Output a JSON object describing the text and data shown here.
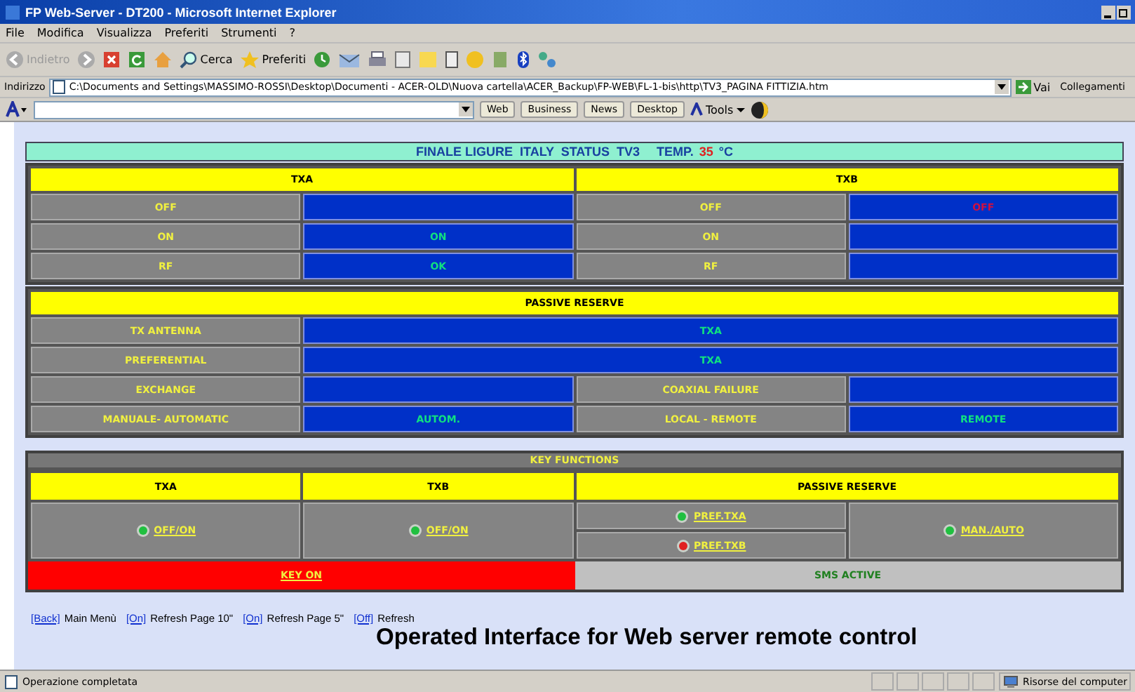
{
  "window": {
    "title": "FP Web-Server - DT200 - Microsoft Internet Explorer"
  },
  "menu": [
    "File",
    "Modifica",
    "Visualizza",
    "Preferiti",
    "Strumenti",
    "?"
  ],
  "toolbar": {
    "back": "Indietro",
    "search": "Cerca",
    "favorites": "Preferiti"
  },
  "address_bar": {
    "label": "Indirizzo",
    "value": "C:\\Documents and Settings\\MASSIMO-ROSSI\\Desktop\\Documenti - ACER-OLD\\Nuova cartella\\ACER_Backup\\FP-WEB\\FL-1-bis\\http\\TV3_PAGINA FITTIZIA.htm",
    "go": "Vai",
    "links": "Collegamenti"
  },
  "search_toolbar": {
    "buttons": [
      "Web",
      "Business",
      "News",
      "Desktop"
    ],
    "tools": "Tools"
  },
  "header": {
    "title": "FINALE LIGURE  ITALY  STATUS  TV3",
    "temp_label": "TEMP.",
    "temp_value": "35",
    "temp_unit": "°C"
  },
  "transmitters": [
    {
      "name": "TXA",
      "rows": [
        {
          "label": "OFF"
        },
        {
          "label": "ON",
          "value": "ON",
          "alarm": false
        },
        {
          "label": "RF",
          "value": "OK",
          "alarm": false
        }
      ]
    },
    {
      "name": "TXB",
      "rows": [
        {
          "label": "OFF",
          "value": "OFF",
          "alarm": true
        },
        {
          "label": "ON"
        },
        {
          "label": "RF"
        }
      ]
    }
  ],
  "passive_reserve": {
    "title": "PASSIVE RESERVE",
    "rows": [
      [
        {
          "kind": "label",
          "text": "TX ANTENNA"
        },
        {
          "kind": "value",
          "text": "TXA",
          "wide": true
        }
      ],
      [
        {
          "kind": "label",
          "text": "PREFERENTIAL"
        },
        {
          "kind": "value",
          "text": "TXA",
          "wide": true
        }
      ],
      [
        {
          "kind": "label",
          "text": "EXCHANGE"
        },
        {
          "kind": "value",
          "wide": false
        },
        {
          "kind": "label",
          "text": "COAXIAL FAILURE"
        },
        {
          "kind": "value",
          "wide": false
        }
      ],
      [
        {
          "kind": "label",
          "text": "MANUALE- AUTOMATIC"
        },
        {
          "kind": "value",
          "text": "AUTOM.",
          "wide": false
        },
        {
          "kind": "label",
          "text": "LOCAL - REMOTE"
        },
        {
          "kind": "value",
          "text": "REMOTE",
          "wide": false
        }
      ]
    ]
  },
  "key_functions": {
    "title": "KEY FUNCTIONS",
    "headers": [
      "TXA",
      "TXB",
      "PASSIVE RESERVE"
    ],
    "keys": [
      {
        "label": "OFF/ON",
        "on": true
      },
      {
        "label": "OFF/ON",
        "on": true
      },
      {
        "label": "PREF.TXA",
        "on": true
      },
      {
        "label": "PREF.TXB",
        "on": false
      },
      {
        "label": "MAN./AUTO",
        "on": true
      }
    ],
    "indicators": [
      {
        "label": "KEY ON",
        "active": true
      },
      {
        "label": "SMS ACTIVE",
        "active": false
      }
    ]
  },
  "footer_links": [
    {
      "link": "[Back]",
      "text": "Main Menù"
    },
    {
      "link": "[On]",
      "text": "Refresh Page 10\""
    },
    {
      "link": "[On]",
      "text": "Refresh Page 5\""
    },
    {
      "link": "[Off]",
      "text": "Refresh"
    }
  ],
  "caption": "Operated Interface for Web server remote control",
  "status_bar": {
    "message": "Operazione completata",
    "zone": "Risorse del computer"
  }
}
